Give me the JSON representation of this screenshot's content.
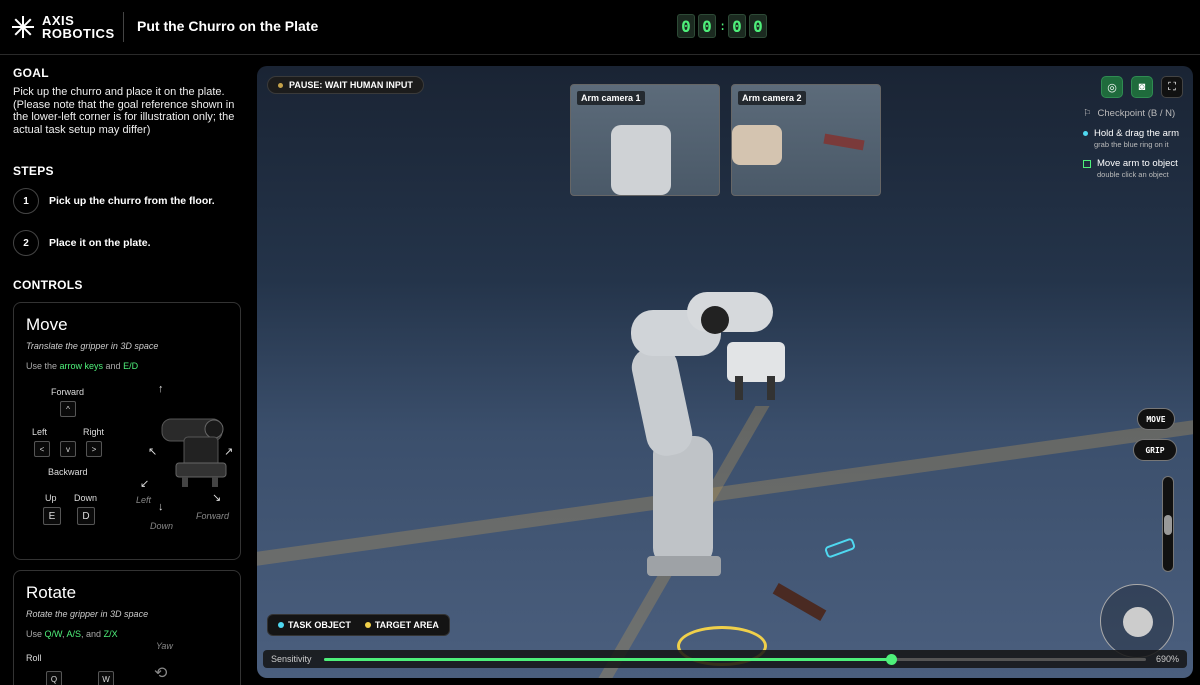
{
  "header": {
    "logo_line1": "AXIS",
    "logo_line2": "ROBOTICS",
    "task_title": "Put the Churro on the Plate",
    "timer": [
      "0",
      "0",
      "0",
      "0"
    ]
  },
  "sidebar": {
    "goal_title": "GOAL",
    "goal_text": "Pick up the churro and place it on the plate. (Please note that the goal reference shown in the lower-left corner is for illustration only; the actual task setup may differ)",
    "steps_title": "STEPS",
    "steps": [
      {
        "num": "1",
        "label": "Pick up the churro from the floor."
      },
      {
        "num": "2",
        "label": "Place it on the plate."
      }
    ],
    "controls_title": "CONTROLS",
    "move": {
      "title": "Move",
      "subtitle": "Translate the gripper in 3D space",
      "hint_prefix": "Use the ",
      "hint_key1": "arrow keys",
      "hint_mid": " and ",
      "hint_key2": "E/D",
      "forward": "Forward",
      "left": "Left",
      "right": "Right",
      "backward": "Backward",
      "up": "Up",
      "down": "Down",
      "key_up": "^",
      "key_left": "<",
      "key_down": "v",
      "key_right": ">",
      "key_e": "E",
      "key_d": "D",
      "dir_left": "Left",
      "dir_down": "Down",
      "dir_forward": "Forward"
    },
    "rotate": {
      "title": "Rotate",
      "subtitle": "Rotate the gripper in 3D space",
      "hint_prefix": "Use ",
      "hint_key1": "Q/W",
      "hint_sep1": ", ",
      "hint_key2": "A/S",
      "hint_sep2": ", and ",
      "hint_key3": "Z/X",
      "roll": "Roll",
      "yaw": "Yaw",
      "key_q": "Q",
      "key_w": "W"
    }
  },
  "viewport": {
    "pause_label": "PAUSE: WAIT HUMAN INPUT",
    "cameras": [
      "Arm camera 1",
      "Arm camera 2"
    ],
    "checkpoint": "Checkpoint (B / N)",
    "hold_drag": "Hold & drag the arm",
    "hold_drag_sub": "grab the blue ring on it",
    "move_to_object": "Move arm to object",
    "move_to_object_sub": "double click an object",
    "move_btn": "MOVE",
    "grip_btn": "GRIP",
    "legend_task": "TASK OBJECT",
    "legend_target": "TARGET AREA",
    "sensitivity_label": "Sensitivity",
    "sensitivity_value": "690%",
    "sensitivity_fraction": 0.69
  },
  "colors": {
    "accent_green": "#4ef07a",
    "task_object": "#4fd8f0",
    "target_area": "#f0d04a"
  }
}
